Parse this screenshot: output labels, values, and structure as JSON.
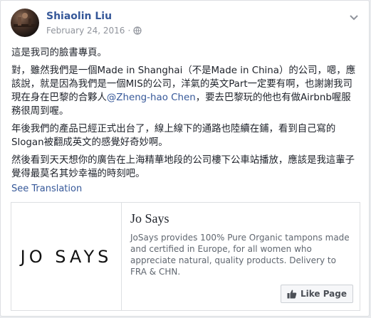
{
  "post": {
    "author": "Shiaolin Liu",
    "date": "February 24, 2016",
    "separator": "·",
    "paragraphs": [
      "這是我司的臉書專頁。",
      {
        "before": "對，雖然我們是一個Made in Shanghai（不是Made in China）的公司，嗯，應該說，就是因為我們是一個MIS的公司，洋氣的英文Part一定要有啊，也謝謝我司現在身在巴黎的合夥人",
        "mention": "@Zheng-hao Chen",
        "after": "，要去巴黎玩的他也有做Airbnb喔服務很周到喔。"
      },
      "年後我們的產品已經正式出台了，線上線下的通路也陸續在鋪，看到自己寫的Slogan被翻成英文的感覺好奇妙啊。",
      "然後看到天天想你的廣告在上海精華地段的公司樓下公車站播放，應該是我這輩子覺得最莫名其妙幸福的時刻吧。"
    ],
    "see_translation": "See Translation"
  },
  "attachment": {
    "logo_text": "JO SAYS",
    "title": "Jo Says",
    "description": "JoSays provides 100% Pure Organic tampons made and certified in Europe, for all women who appreciate natural, quality products. Delivery to FRA & CHN.",
    "like_button": "Like Page"
  },
  "colors": {
    "link": "#365899",
    "text": "#1d2129",
    "muted": "#90949c"
  },
  "icons": {
    "privacy": "globe-icon",
    "options": "chevron-down-icon",
    "like": "thumbs-up-icon"
  }
}
